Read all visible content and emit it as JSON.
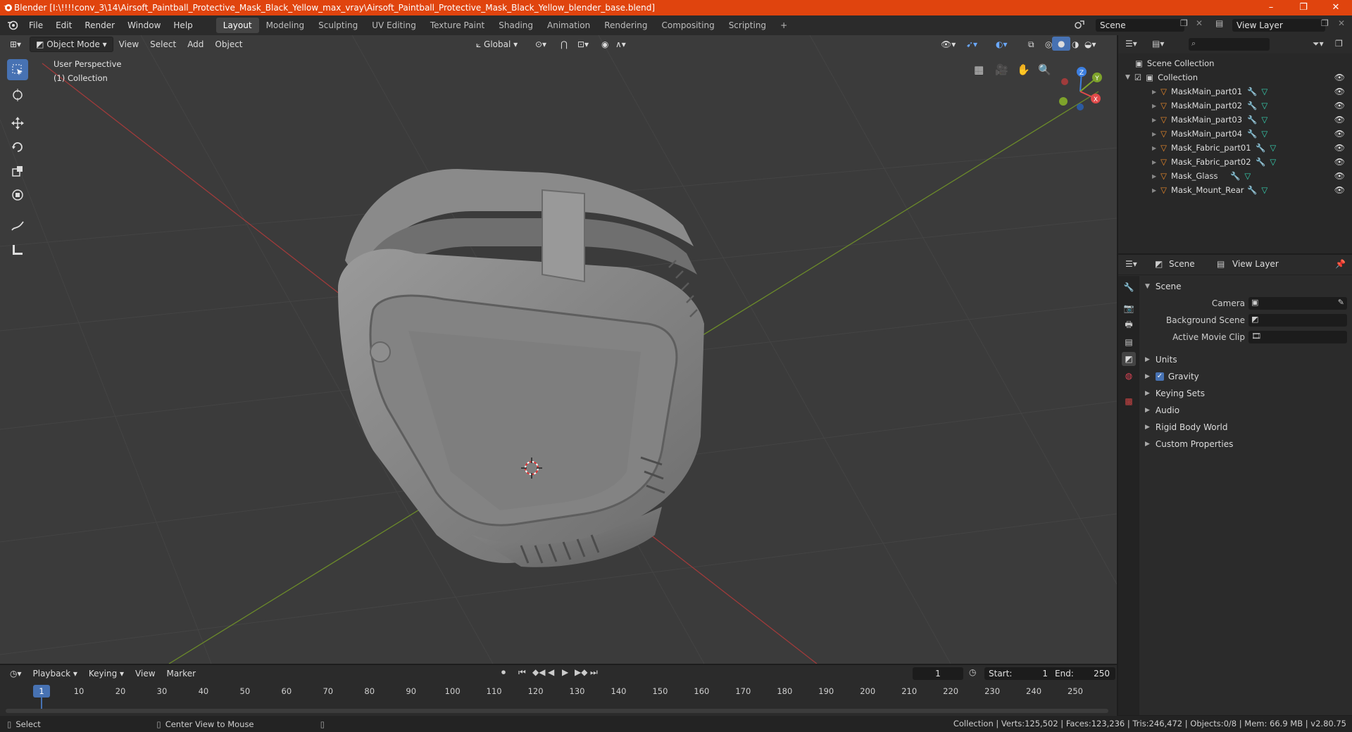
{
  "window": {
    "title": "Blender [I:\\!!!!conv_3\\14\\Airsoft_Paintball_Protective_Mask_Black_Yellow_max_vray\\Airsoft_Paintball_Protective_Mask_Black_Yellow_blender_base.blend]",
    "minimize": "–",
    "restore": "❐",
    "close": "✕"
  },
  "menus": [
    "File",
    "Edit",
    "Render",
    "Window",
    "Help"
  ],
  "workspaces": [
    "Layout",
    "Modeling",
    "Sculpting",
    "UV Editing",
    "Texture Paint",
    "Shading",
    "Animation",
    "Rendering",
    "Compositing",
    "Scripting"
  ],
  "active_workspace": "Layout",
  "add_workspace": "+",
  "scene_selector": {
    "value": "Scene"
  },
  "view_layer_selector": {
    "value": "View Layer"
  },
  "viewport": {
    "mode": "Object Mode",
    "menus": [
      "View",
      "Select",
      "Add",
      "Object"
    ],
    "orientation": "Global",
    "overlay_title": "User Perspective",
    "overlay_collection": "(1) Collection",
    "gizmo": {
      "x": "X",
      "y": "Y",
      "z": "Z"
    }
  },
  "outliner": {
    "search_placeholder": "",
    "root": "Scene Collection",
    "collection": "Collection",
    "items": [
      {
        "name": "MaskMain_part01"
      },
      {
        "name": "MaskMain_part02"
      },
      {
        "name": "MaskMain_part03"
      },
      {
        "name": "MaskMain_part04"
      },
      {
        "name": "Mask_Fabric_part01"
      },
      {
        "name": "Mask_Fabric_part02"
      },
      {
        "name": "Mask_Glass"
      },
      {
        "name": "Mask_Mount_Rear"
      }
    ]
  },
  "properties": {
    "header_scene": "Scene",
    "header_view_layer": "View Layer",
    "section": "Scene",
    "fields": [
      {
        "label": "Camera"
      },
      {
        "label": "Background Scene"
      },
      {
        "label": "Active Movie Clip"
      }
    ],
    "panels": [
      {
        "label": "Units",
        "checkbox": false
      },
      {
        "label": "Gravity",
        "checkbox": true
      },
      {
        "label": "Keying Sets",
        "checkbox": false
      },
      {
        "label": "Audio",
        "checkbox": false
      },
      {
        "label": "Rigid Body World",
        "checkbox": false
      },
      {
        "label": "Custom Properties",
        "checkbox": false
      }
    ]
  },
  "timeline": {
    "menus": [
      "Playback",
      "Keying",
      "View",
      "Marker"
    ],
    "current_frame": "1",
    "start_label": "Start:",
    "start": "1",
    "end_label": "End:",
    "end": "250",
    "ticks": [
      "1",
      "10",
      "20",
      "30",
      "40",
      "50",
      "60",
      "70",
      "80",
      "90",
      "100",
      "110",
      "120",
      "130",
      "140",
      "150",
      "160",
      "170",
      "180",
      "190",
      "200",
      "210",
      "220",
      "230",
      "240",
      "250"
    ]
  },
  "statusbar": {
    "select": "Select",
    "center_view": "Center View to Mouse",
    "stats": "Collection | Verts:125,502 | Faces:123,236 | Tris:246,472 | Objects:0/8 | Mem: 66.9 MB | v2.80.75"
  },
  "colors": {
    "title_bar": "#e0440e",
    "accent": "#4772b3",
    "x_axis": "#e04a4a",
    "y_axis": "#7ea32b",
    "z_axis": "#3d7fe0",
    "mesh_icon": "#e8882a",
    "modifier_icon": "#6aa9ff",
    "data_icon": "#36d0b0"
  }
}
